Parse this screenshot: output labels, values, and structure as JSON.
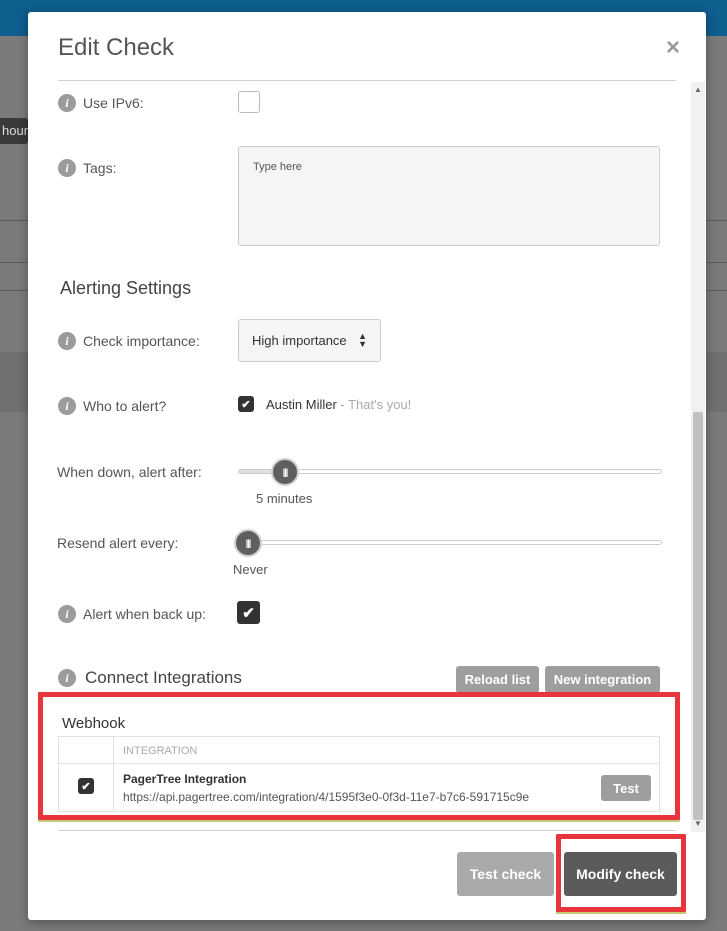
{
  "background": {
    "chip_text": "hour"
  },
  "modal": {
    "title": "Edit Check",
    "close_label": "×"
  },
  "form": {
    "use_ipv6_label": "Use IPv6:",
    "tags_label": "Tags:",
    "tags_placeholder": "Type here",
    "alerting_title": "Alerting Settings",
    "check_importance_label": "Check importance:",
    "check_importance_value": "High importance",
    "who_to_alert_label": "Who to alert?",
    "alert_user_name": "Austin Miller",
    "alert_user_note": " - That's you!",
    "when_down_label": "When down, alert after:",
    "when_down_value": "5 minutes",
    "when_down_position": 0.11,
    "resend_label": "Resend alert every:",
    "resend_value": "Never",
    "resend_position": 0.0,
    "alert_back_up_label": "Alert when back up:",
    "alert_back_up_checked": true,
    "use_ipv6_checked": false
  },
  "integrations": {
    "title": "Connect Integrations",
    "reload_label": "Reload list",
    "new_label": "New integration",
    "webhook_title": "Webhook",
    "column_header": "INTEGRATION",
    "rows": [
      {
        "checked": true,
        "name": "PagerTree Integration",
        "url": "https://api.pagertree.com/integration/4/1595f3e0-0f3d-11e7-b7c6-591715c9e",
        "test_label": "Test"
      }
    ]
  },
  "footer": {
    "test_check_label": "Test check",
    "modify_check_label": "Modify check"
  },
  "icons": {
    "info": "info-icon",
    "close": "close-icon",
    "check": "checkmark-icon",
    "select_arrows": "sort-arrows-icon",
    "slider_grip": "grip-icon"
  },
  "colors": {
    "header_blue": "#0e5e8e",
    "highlight_red": "#e8353b",
    "button_dark": "#5b5b5b",
    "button_gray": "#9e9e9e"
  }
}
